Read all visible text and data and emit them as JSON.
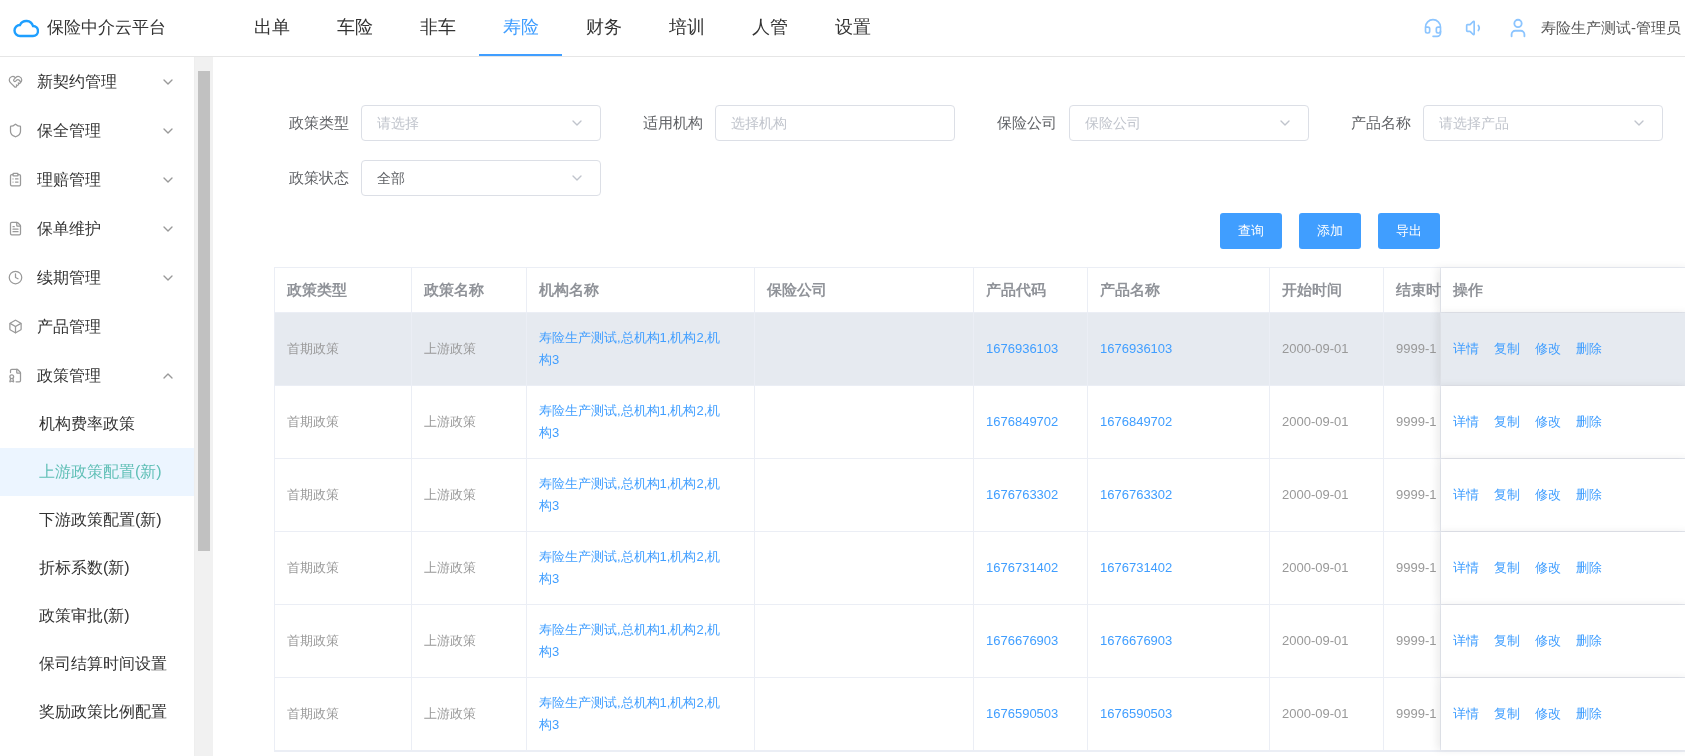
{
  "brand": {
    "title": "保险中介云平台"
  },
  "nav": [
    {
      "label": "出单",
      "selected": false
    },
    {
      "label": "车险",
      "selected": false
    },
    {
      "label": "非车",
      "selected": false
    },
    {
      "label": "寿险",
      "selected": true
    },
    {
      "label": "财务",
      "selected": false
    },
    {
      "label": "培训",
      "selected": false
    },
    {
      "label": "人管",
      "selected": false
    },
    {
      "label": "设置",
      "selected": false
    }
  ],
  "user": "寿险生产测试-管理员",
  "sidebar": [
    {
      "label": "新契约管理",
      "expanded": false
    },
    {
      "label": "保全管理",
      "expanded": false
    },
    {
      "label": "理赔管理",
      "expanded": false
    },
    {
      "label": "保单维护",
      "expanded": false
    },
    {
      "label": "续期管理",
      "expanded": false
    },
    {
      "label": "产品管理"
    },
    {
      "label": "政策管理",
      "expanded": true,
      "children": [
        {
          "label": "机构费率政策",
          "selected": false
        },
        {
          "label": "上游政策配置(新)",
          "selected": true
        },
        {
          "label": "下游政策配置(新)",
          "selected": false
        },
        {
          "label": "折标系数(新)",
          "selected": false
        },
        {
          "label": "政策审批(新)",
          "selected": false
        },
        {
          "label": "保司结算时间设置",
          "selected": false
        },
        {
          "label": "奖励政策比例配置",
          "selected": false
        }
      ]
    }
  ],
  "filters": [
    {
      "label": "政策类型",
      "kind": "select",
      "placeholder": "请选择"
    },
    {
      "label": "适用机构",
      "kind": "input",
      "placeholder": "选择机构"
    },
    {
      "label": "保险公司",
      "kind": "select",
      "placeholder": "保险公司"
    },
    {
      "label": "产品名称",
      "kind": "select",
      "placeholder": "请选择产品"
    },
    {
      "label": "政策状态",
      "kind": "select",
      "value": "全部"
    }
  ],
  "buttons": [
    "查询",
    "添加",
    "导出"
  ],
  "table": {
    "columns": [
      "政策类型",
      "政策名称",
      "机构名称",
      "保险公司",
      "产品代码",
      "产品名称",
      "开始时间",
      "结束时",
      "操作"
    ],
    "rows": [
      {
        "type": "首期政策",
        "name": "上游政策",
        "org": "寿险生产测试,总机构1,机构2,机构3",
        "company": "",
        "code": "1676936103",
        "product": "1676936103",
        "start": "2000-09-01",
        "end": "9999-1",
        "hovered": true,
        "actions": [
          "详情",
          "复制",
          "修改",
          "删除"
        ]
      },
      {
        "type": "首期政策",
        "name": "上游政策",
        "org": "寿险生产测试,总机构1,机构2,机构3",
        "company": "",
        "code": "1676849702",
        "product": "1676849702",
        "start": "2000-09-01",
        "end": "9999-1",
        "hovered": false,
        "actions": [
          "详情",
          "复制",
          "修改",
          "删除"
        ]
      },
      {
        "type": "首期政策",
        "name": "上游政策",
        "org": "寿险生产测试,总机构1,机构2,机构3",
        "company": "",
        "code": "1676763302",
        "product": "1676763302",
        "start": "2000-09-01",
        "end": "9999-1",
        "hovered": false,
        "actions": [
          "详情",
          "复制",
          "修改",
          "删除"
        ]
      },
      {
        "type": "首期政策",
        "name": "上游政策",
        "org": "寿险生产测试,总机构1,机构2,机构3",
        "company": "",
        "code": "1676731402",
        "product": "1676731402",
        "start": "2000-09-01",
        "end": "9999-1",
        "hovered": false,
        "actions": [
          "详情",
          "复制",
          "修改",
          "删除"
        ]
      },
      {
        "type": "首期政策",
        "name": "上游政策",
        "org": "寿险生产测试,总机构1,机构2,机构3",
        "company": "",
        "code": "1676676903",
        "product": "1676676903",
        "start": "2000-09-01",
        "end": "9999-1",
        "hovered": false,
        "actions": [
          "详情",
          "复制",
          "修改",
          "删除"
        ]
      },
      {
        "type": "首期政策",
        "name": "上游政策",
        "org": "寿险生产测试,总机构1,机构2,机构3",
        "company": "",
        "code": "1676590503",
        "product": "1676590503",
        "start": "2000-09-01",
        "end": "9999-1",
        "hovered": false,
        "actions": [
          "详情",
          "复制",
          "修改",
          "删除"
        ]
      }
    ]
  }
}
